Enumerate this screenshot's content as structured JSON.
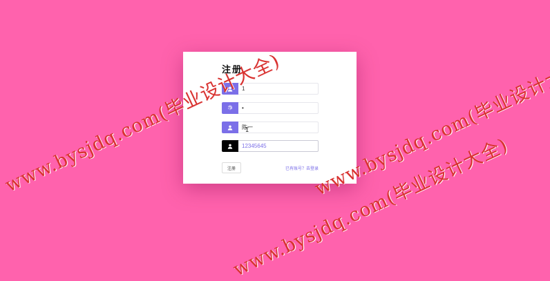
{
  "form": {
    "title": "注册",
    "fields": [
      {
        "icon": "user-icon",
        "value": "1"
      },
      {
        "icon": "fingerprint-icon",
        "value": "•"
      },
      {
        "icon": "user-icon",
        "value": "陈一"
      },
      {
        "icon": "user-icon",
        "value": "12345645"
      }
    ],
    "register_button": "注册",
    "login_link": "已有账号？去登录"
  },
  "watermark": {
    "text": "www.bysjdq.com(毕业设计大全)",
    "color": "#d8322f"
  },
  "colors": {
    "background": "#ff62ad",
    "accent": "#7b6fe8",
    "card": "#ffffff"
  }
}
